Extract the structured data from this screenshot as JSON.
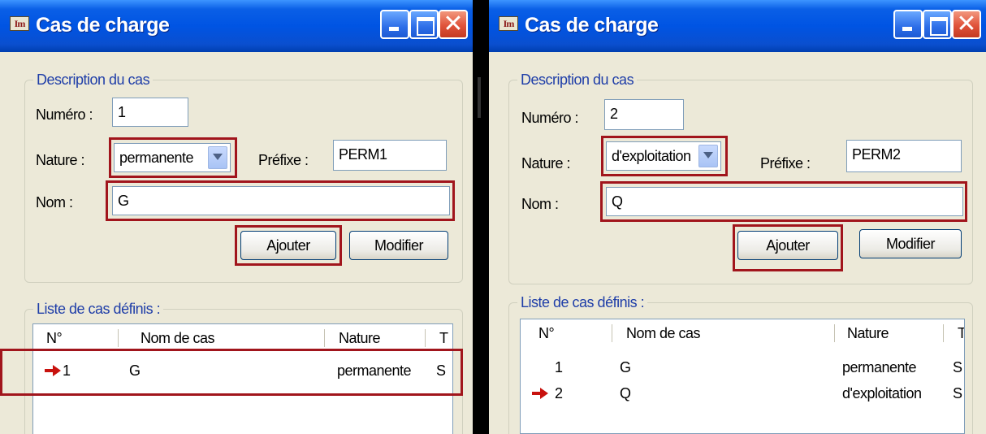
{
  "windows": [
    {
      "title": "Cas de charge",
      "icon": "app-icon",
      "description_group": {
        "label": "Description du cas",
        "numero_label": "Numéro :",
        "numero_value": "1",
        "nature_label": "Nature :",
        "nature_value": "permanente",
        "prefixe_label": "Préfixe :",
        "prefixe_value": "PERM1",
        "nom_label": "Nom :",
        "nom_value": "G",
        "add_button": "Ajouter",
        "modify_button": "Modifier"
      },
      "list_group": {
        "label": "Liste de cas définis :",
        "columns": [
          "N°",
          "Nom de cas",
          "Nature",
          "T"
        ],
        "rows": [
          {
            "number": "1",
            "name": "G",
            "nature": "permanente",
            "type": "S",
            "current": true
          }
        ]
      }
    },
    {
      "title": "Cas de charge",
      "icon": "app-icon",
      "description_group": {
        "label": "Description du cas",
        "numero_label": "Numéro :",
        "numero_value": "2",
        "nature_label": "Nature :",
        "nature_value": "d'exploitation",
        "prefixe_label": "Préfixe :",
        "prefixe_value": "PERM2",
        "nom_label": "Nom :",
        "nom_value": "Q",
        "add_button": "Ajouter",
        "modify_button": "Modifier"
      },
      "list_group": {
        "label": "Liste de cas définis :",
        "columns": [
          "N°",
          "Nom de cas",
          "Nature",
          "T"
        ],
        "rows": [
          {
            "number": "1",
            "name": "G",
            "nature": "permanente",
            "type": "S",
            "current": false
          },
          {
            "number": "2",
            "name": "Q",
            "nature": "d'exploitation",
            "type": "S",
            "current": true
          }
        ]
      }
    }
  ],
  "colors": {
    "title_bar": "#0054e3",
    "highlight_box": "#a1151c",
    "current_arrow": "#c8120e",
    "group_label": "#1f3ea8"
  }
}
